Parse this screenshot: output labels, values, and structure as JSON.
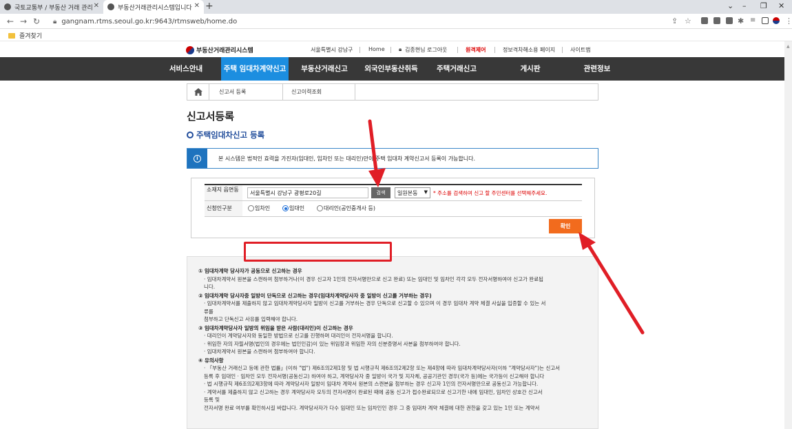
{
  "browser": {
    "tabs": [
      {
        "title": "국토교통부 / 부동산 거래 관리"
      },
      {
        "title": "부동산거래관리시스템입니다"
      }
    ],
    "new_tab": "+",
    "url": "gangnam.rtms.seoul.go.kr:9643/rtmsweb/home.do",
    "bookmark": "즐겨찾기"
  },
  "header": {
    "logo_text": "부동산거래관리시스템",
    "links": [
      "서울특별시 강남구",
      "Home",
      "김종현님 로그아웃",
      "원격제어",
      "정보격차해소용 페이지",
      "사이트맵"
    ]
  },
  "gnb": [
    "서비스안내",
    "주택 임대차계약신고",
    "부동산거래신고",
    "외국인부동산취득",
    "주택거래신고",
    "게시판",
    "관련정보"
  ],
  "breadcrumb": [
    "신고서 등록",
    "신고이력조회"
  ],
  "page": {
    "title": "신고서등록",
    "subtitle": "주택임대차신고 등록",
    "notice": "본 시스템은 법적인 효력을 가진자(임대인, 임차인 또는 대리인)만이 주택 임대차 계약신고서 등록이 가능합니다."
  },
  "form": {
    "location_label": "소재지 읍면동",
    "address_value": "서울특별시 강남구  광평로20길",
    "search_label": "검색",
    "office_select": "일원본동",
    "address_hint": "* 주소를 검색하여 신고 할 주민센터를 선택해주세요.",
    "applicant_label": "신청인구분",
    "options": [
      "임차인",
      "임대인",
      "대리인(공인중개사 등)"
    ],
    "selected_option": "임대인",
    "confirm_label": "확인"
  },
  "guide": [
    {
      "title": "① 임대차계약 당사자가 공동으로 신고하는 경우",
      "lines": [
        "· 임대차계약서 원본을 스캔하여 첨부하거나(이 경우 신고자 1인의 전자서명만으로 신고 완료) 또는 임대인 및 임차인 각각 모두 전자서명하여야 신고가 완료됩",
        "니다."
      ]
    },
    {
      "title": "② 임대차계약 당사자중 일방이 단독으로 신고하는 경우(임대차계약당사자 중 일방이 신고를 거부하는 경우)",
      "lines": [
        "· 임대차계약서를 제출하지 않고 임대차계약당사자 일방이 신고를 거부하는 경우 단독으로 신고할 수 있으며 이 경우 임대차 계약 체결 사실을 입증할 수 있는 서",
        "류를",
        "첨부하고 단독신고 사유를 입력해야 합니다."
      ]
    },
    {
      "title": "③ 임대차계약당사자 일방의 위임을 받은 사람(대리인)이 신고하는 경우",
      "lines": [
        "· 대리인이 계약당사자와 동일한 방법으로 신고를 진행하며 대리인이 전자서명을 합니다.",
        "· 위임한 자의 자필서명(법인의 경우에는 법인인감)이 있는 위임장과 위임한 자의 신분증명서 사본을 첨부하여야 합니다.",
        "· 임대차계약서 원본을 스캔하여 첨부하여야 합니다."
      ]
    },
    {
      "title": "④ 유의사항",
      "lines": [
        "· 「부동산 거래신고 등에 관한 법률」(이하 \"법\") 제6조의2제1항 및 법 시행규칙 제6조의2제2항 또는 제4항에 따라 임대차계약당사자(이하 \"계약당사자\")는 신고서",
        "등록 후 임대인 · 임차인 모두 전자서명(공동신고) 하여야 하고, 계약당사자 중 일방이 국가 및 지자체, 공공기관인 경우(국가 등)에는 국가등이 신고해야 합니다",
        "· 법 시행규칙 제6조의2제3항에 따라 계약당사자 일방이 임대차 계약서 원본의 스캔본을 첨부하는 경우 신고자 1인의 전자서명만으로 공동신고 가능합니다.",
        "· 계약서를 제출하지 않고 신고하는 경우 계약당사자 모두의 전자서명이 완료된 때에 공동 신고가 접수완료되므로 신고기한 내에 임대인, 임차인 상호간 신고서",
        "등록 및",
        "전자서명 완료 여부를 확인하시길 바랍니다. 계약당사자가 다수 임대인 또는 임차인인 경우 그 중 임대차 계약 체결에 대한 권한을 갖고 있는 1인 또는 계약서"
      ]
    }
  ],
  "colors": {
    "gnb_bg": "#383838",
    "gnb_active": "#1c8ee0",
    "confirm": "#f26b1d",
    "annotation": "#e01e26"
  }
}
